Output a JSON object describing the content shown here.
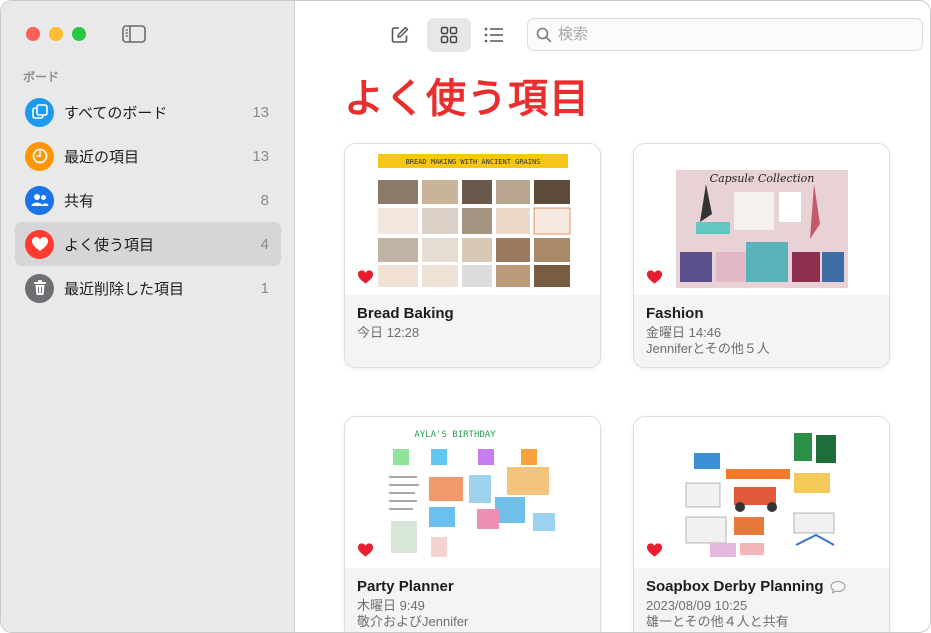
{
  "sidebar": {
    "section_label": "ボード",
    "items": [
      {
        "label": "すべてのボード",
        "count": "13",
        "icon": "boards-icon",
        "color": "#1e9bf0"
      },
      {
        "label": "最近の項目",
        "count": "13",
        "icon": "clock-icon",
        "color": "#ff9500"
      },
      {
        "label": "共有",
        "count": "8",
        "icon": "people-icon",
        "color": "#1a73e8"
      },
      {
        "label": "よく使う項目",
        "count": "4",
        "icon": "heart-icon",
        "color": "#ff3b30"
      },
      {
        "label": "最近削除した項目",
        "count": "1",
        "icon": "trash-icon",
        "color": "#6e6e73"
      }
    ],
    "selected_index": 3
  },
  "toolbar": {
    "new_board": "compose-icon",
    "grid_view": "grid-icon",
    "list_view": "list-icon",
    "search_placeholder": "検索"
  },
  "main": {
    "title": "よく使う項目",
    "title_color": "#ea2d2d",
    "boards": [
      {
        "title": "Bread Baking",
        "meta1": "今日 12:28",
        "meta2": "",
        "favorite": true,
        "thumb_caption": "BREAD MAKING WITH ANCIENT GRAINS"
      },
      {
        "title": "Fashion",
        "meta1": "金曜日 14:46",
        "meta2": "Jenniferとその他５人",
        "favorite": true,
        "thumb_caption": "Capsule Collection"
      },
      {
        "title": "Party Planner",
        "meta1": "木曜日 9:49",
        "meta2": "敬介およびJennifer",
        "favorite": true,
        "thumb_caption": "AYLA'S BIRTHDAY"
      },
      {
        "title": "Soapbox Derby Planning",
        "meta1": "2023/08/09 10:25",
        "meta2": "雄一とその他４人と共有",
        "favorite": true,
        "has_comment": true
      }
    ]
  }
}
